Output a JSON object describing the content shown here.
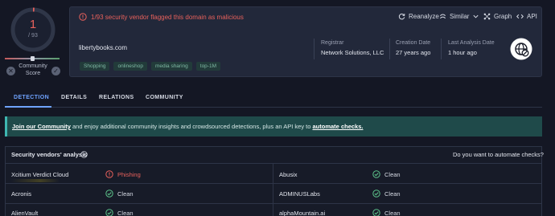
{
  "score": {
    "detections": "1",
    "total": "/ 93",
    "community_label_line1": "Community",
    "community_label_line2": "Score",
    "malicious_color": "#e8615c"
  },
  "alert": {
    "text": "1/93 security vendor flagged this domain as malicious",
    "icon": "alert-circle-icon"
  },
  "toolbar": {
    "reanalyze": "Reanalyze",
    "similar": "Similar",
    "graph": "Graph",
    "api": "API"
  },
  "domain": {
    "name": "libertybooks.com",
    "tags": [
      "Shopping",
      "onlineshop",
      "media sharing",
      "top-1M"
    ]
  },
  "meta": {
    "registrar_label": "Registrar",
    "registrar_value": "Network Solutions, LLC",
    "creation_label": "Creation Date",
    "creation_value": "27 years ago",
    "last_analysis_label": "Last Analysis Date",
    "last_analysis_value": "1 hour ago"
  },
  "tabs": [
    "DETECTION",
    "DETAILS",
    "RELATIONS",
    "COMMUNITY"
  ],
  "banner": {
    "link_join": "Join our Community",
    "text_middle": " and enjoy additional community insights and crowdsourced detections, plus an API key to ",
    "link_automate": "automate checks."
  },
  "vendors": {
    "title": "Security vendors' analysis",
    "automate_question": "Do you want to automate checks?",
    "rows": [
      {
        "left_name": "Xcitium Verdict Cloud",
        "left_verdict": "Phishing",
        "left_status": "malicious",
        "right_name": "Abusix",
        "right_verdict": "Clean",
        "right_status": "clean"
      },
      {
        "left_name": "Acronis",
        "left_verdict": "Clean",
        "left_status": "clean",
        "right_name": "ADMINUSLabs",
        "right_verdict": "Clean",
        "right_status": "clean"
      },
      {
        "left_name": "AlienVault",
        "left_verdict": "Clean",
        "left_status": "clean",
        "right_name": "alphaMountain.ai",
        "right_verdict": "Clean",
        "right_status": "clean"
      }
    ]
  },
  "colors": {
    "accent": "#6fa3ff",
    "clean": "#5cc28a",
    "malicious": "#e8615c",
    "banner_bg": "#1f4a4a"
  }
}
